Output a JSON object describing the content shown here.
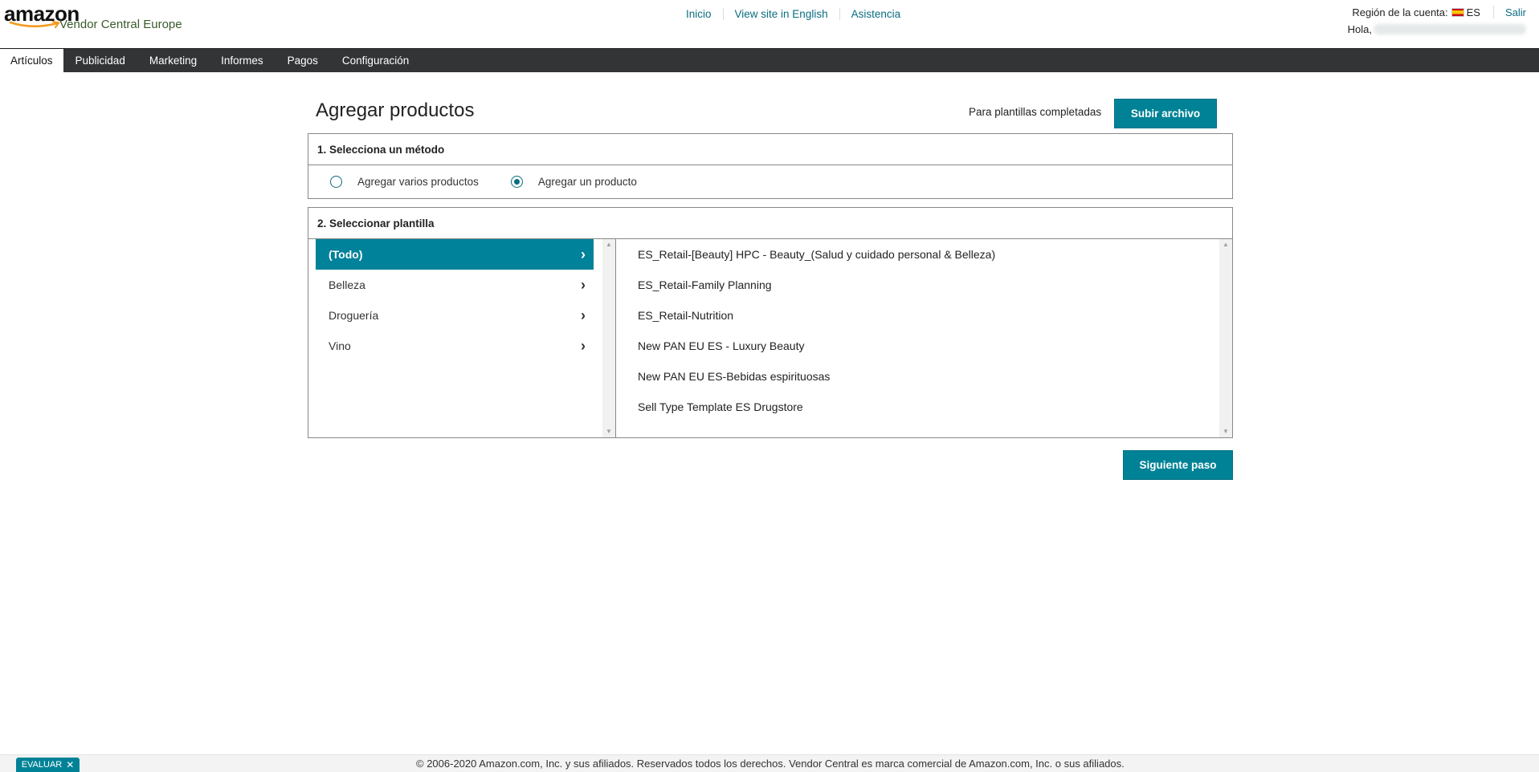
{
  "logo": {
    "brand": "amazon",
    "product": "Vendor Central Europe"
  },
  "top_links": [
    "Inicio",
    "View site in English",
    "Asistencia"
  ],
  "account": {
    "region_label": "Región de la cuenta:",
    "region_code": "ES",
    "logout": "Salir",
    "greeting": "Hola,"
  },
  "nav": {
    "items": [
      "Artículos",
      "Publicidad",
      "Marketing",
      "Informes",
      "Pagos",
      "Configuración"
    ],
    "active": "Artículos"
  },
  "main": {
    "title": "Agregar productos",
    "upload_text": "Para plantillas completadas",
    "upload_button": "Subir archivo",
    "next_button": "Siguiente paso"
  },
  "step1": {
    "heading": "1. Selecciona un método",
    "options": [
      {
        "label": "Agregar varios productos",
        "checked": false
      },
      {
        "label": "Agregar un producto",
        "checked": true
      }
    ]
  },
  "step2": {
    "heading": "2. Seleccionar plantilla",
    "categories": [
      {
        "label": "(Todo)",
        "selected": true
      },
      {
        "label": "Belleza",
        "selected": false
      },
      {
        "label": "Droguería",
        "selected": false
      },
      {
        "label": "Vino",
        "selected": false
      }
    ],
    "templates": [
      "ES_Retail-[Beauty] HPC - Beauty_(Salud y cuidado personal & Belleza)",
      "ES_Retail-Family Planning",
      "ES_Retail-Nutrition",
      "New PAN EU ES - Luxury Beauty",
      "New PAN EU ES-Bebidas espirituosas",
      "Sell Type Template ES Drugstore"
    ]
  },
  "footer": {
    "copyright": "© 2006-2020 Amazon.com, Inc. y sus afiliados. Reservados todos los derechos. Vendor Central es marca comercial de Amazon.com, Inc. o sus afiliados."
  },
  "feedback": {
    "label": "EVALUAR"
  },
  "colors": {
    "accent": "#008296",
    "nav_bg": "#333436",
    "link": "#0a6d80"
  }
}
